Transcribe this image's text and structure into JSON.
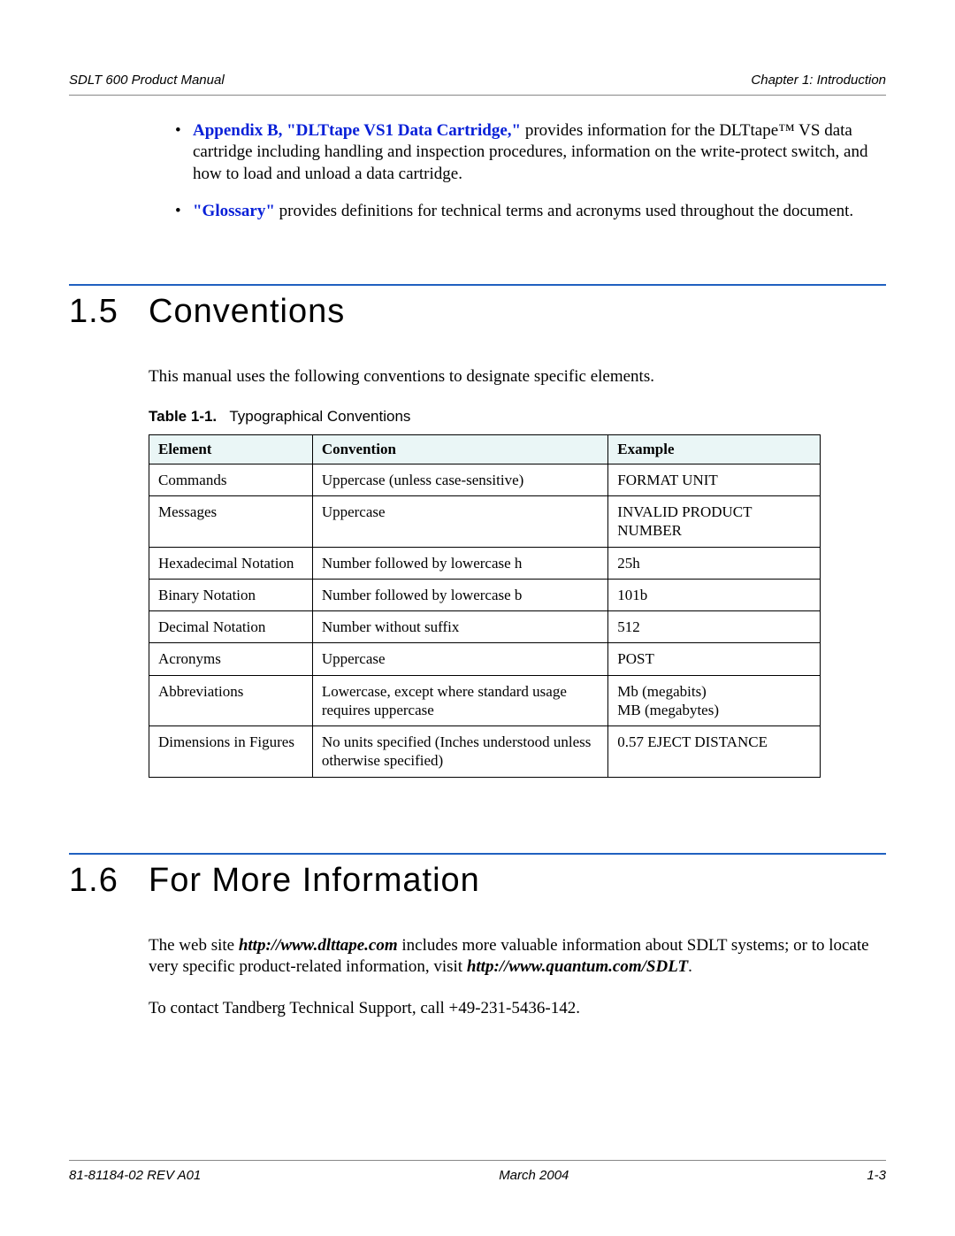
{
  "header": {
    "left": "SDLT 600 Product Manual",
    "right": "Chapter 1:  Introduction"
  },
  "bullets": [
    {
      "link": "Appendix B, \"DLTtape VS1 Data Cartridge,\"",
      "rest": " provides information for the DLTtape™ VS data cartridge including handling and inspection procedures, information on the write-protect switch, and how to load and unload a data cartridge."
    },
    {
      "link": "\"Glossary\"",
      "rest": " provides definitions for technical terms and acronyms used throughout the document."
    }
  ],
  "section15": {
    "num": "1.5",
    "title": "Conventions",
    "intro": "This manual uses the following conventions to designate specific elements.",
    "tableLabel": "Table 1-1.",
    "tableTitle": "Typographical Conventions",
    "headers": {
      "c1": "Element",
      "c2": "Convention",
      "c3": "Example"
    },
    "rows": [
      {
        "c1": "Commands",
        "c2": "Uppercase (unless case-sensitive)",
        "c3": "FORMAT UNIT"
      },
      {
        "c1": "Messages",
        "c2": "Uppercase",
        "c3": "INVALID PRODUCT NUMBER"
      },
      {
        "c1": "Hexadecimal Notation",
        "c2": "Number followed by lowercase h",
        "c3": "25h"
      },
      {
        "c1": "Binary Notation",
        "c2": "Number followed by lowercase b",
        "c3": "101b"
      },
      {
        "c1": "Decimal Notation",
        "c2": "Number without suffix",
        "c3": "512"
      },
      {
        "c1": "Acronyms",
        "c2": "Uppercase",
        "c3": "POST"
      },
      {
        "c1": "Abbreviations",
        "c2": "Lowercase, except where standard usage requires uppercase",
        "c3": "Mb (megabits)\nMB (megabytes)"
      },
      {
        "c1": "Dimensions in Figures",
        "c2": "No units specified (Inches understood unless otherwise specified)",
        "c3": "0.57 EJECT DISTANCE"
      }
    ]
  },
  "section16": {
    "num": "1.6",
    "title": "For More Information",
    "p1a": "The web site ",
    "p1b": "http://www.dlttape.com",
    "p1c": " includes more valuable information about SDLT systems; or to locate very specific product-related information, visit ",
    "p1d": "http://www.quantum.com/SDLT",
    "p1e": ".",
    "p2": "To contact Tandberg Technical Support, call +49-231-5436-142."
  },
  "footer": {
    "left": "81-81184-02 REV A01",
    "center": "March 2004",
    "right": "1-3"
  }
}
